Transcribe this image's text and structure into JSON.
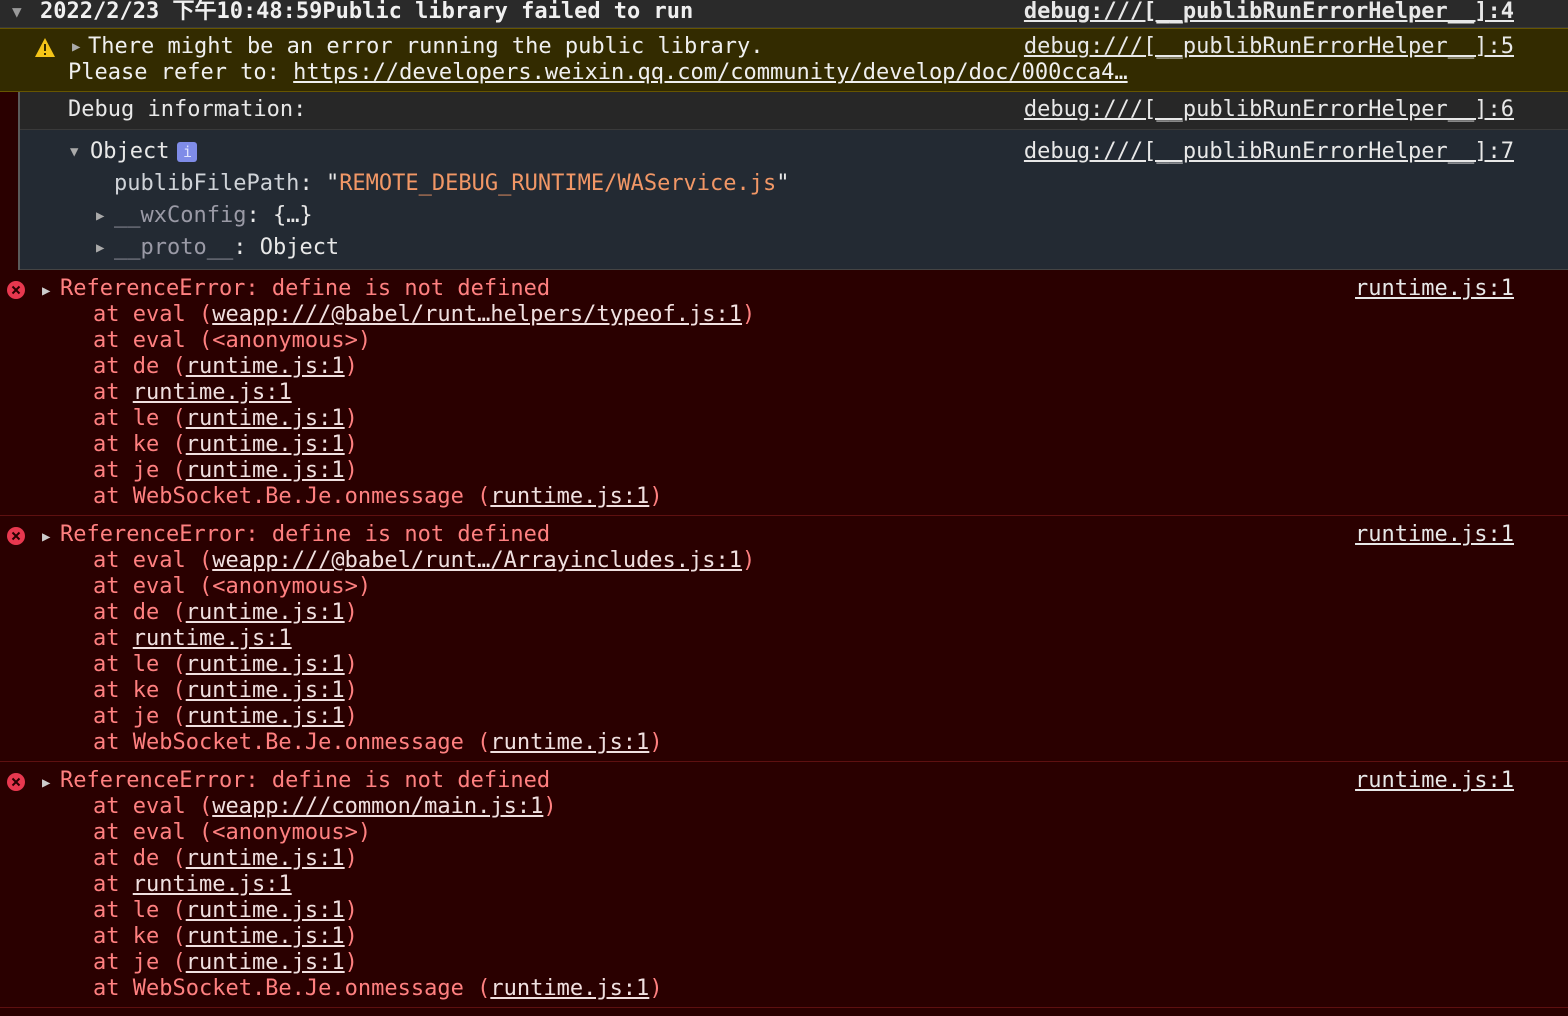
{
  "group": {
    "timestamp_title": "2022/2/23 下午10:48:59Public library failed to run",
    "source": "debug:///[__publibRunErrorHelper__]:4"
  },
  "warning": {
    "line1": "There might be an error running the public library.",
    "line2_prefix": "Please refer to: ",
    "link": "https://developers.weixin.qq.com/community/develop/doc/000cca4…",
    "source": "debug:///[__publibRunErrorHelper__]:5"
  },
  "debug_info": {
    "text": "Debug information:",
    "source": "debug:///[__publibRunErrorHelper__]:6"
  },
  "object": {
    "label": "Object",
    "badge": "i",
    "source": "debug:///[__publibRunErrorHelper__]:7",
    "prop1_key": "publibFilePath",
    "prop1_colon": ": ",
    "prop1_value": "REMOTE_DEBUG_RUNTIME/WAService.js",
    "prop2_key": "__wxConfig",
    "prop2_value": ": {…}",
    "prop3_key": "__proto__",
    "prop3_value": ": Object"
  },
  "errors": [
    {
      "message": "ReferenceError: define is not defined",
      "source": "runtime.js:1",
      "frames": [
        {
          "prefix": "at eval (",
          "link": "weapp:///@babel/runt…helpers/typeof.js:1",
          "suffix": ")"
        },
        {
          "prefix": "at eval (<anonymous>)",
          "link": "",
          "suffix": ""
        },
        {
          "prefix": "at de (",
          "link": "runtime.js:1",
          "suffix": ")"
        },
        {
          "prefix": "at ",
          "link": "runtime.js:1",
          "suffix": ""
        },
        {
          "prefix": "at le (",
          "link": "runtime.js:1",
          "suffix": ")"
        },
        {
          "prefix": "at ke (",
          "link": "runtime.js:1",
          "suffix": ")"
        },
        {
          "prefix": "at je (",
          "link": "runtime.js:1",
          "suffix": ")"
        },
        {
          "prefix": "at WebSocket.Be.Je.onmessage (",
          "link": "runtime.js:1",
          "suffix": ")"
        }
      ]
    },
    {
      "message": "ReferenceError: define is not defined",
      "source": "runtime.js:1",
      "frames": [
        {
          "prefix": "at eval (",
          "link": "weapp:///@babel/runt…/Arrayincludes.js:1",
          "suffix": ")"
        },
        {
          "prefix": "at eval (<anonymous>)",
          "link": "",
          "suffix": ""
        },
        {
          "prefix": "at de (",
          "link": "runtime.js:1",
          "suffix": ")"
        },
        {
          "prefix": "at ",
          "link": "runtime.js:1",
          "suffix": ""
        },
        {
          "prefix": "at le (",
          "link": "runtime.js:1",
          "suffix": ")"
        },
        {
          "prefix": "at ke (",
          "link": "runtime.js:1",
          "suffix": ")"
        },
        {
          "prefix": "at je (",
          "link": "runtime.js:1",
          "suffix": ")"
        },
        {
          "prefix": "at WebSocket.Be.Je.onmessage (",
          "link": "runtime.js:1",
          "suffix": ")"
        }
      ]
    },
    {
      "message": "ReferenceError: define is not defined",
      "source": "runtime.js:1",
      "frames": [
        {
          "prefix": "at eval (",
          "link": "weapp:///common/main.js:1",
          "suffix": ")"
        },
        {
          "prefix": "at eval (<anonymous>)",
          "link": "",
          "suffix": ""
        },
        {
          "prefix": "at de (",
          "link": "runtime.js:1",
          "suffix": ")"
        },
        {
          "prefix": "at ",
          "link": "runtime.js:1",
          "suffix": ""
        },
        {
          "prefix": "at le (",
          "link": "runtime.js:1",
          "suffix": ")"
        },
        {
          "prefix": "at ke (",
          "link": "runtime.js:1",
          "suffix": ")"
        },
        {
          "prefix": "at je (",
          "link": "runtime.js:1",
          "suffix": ")"
        },
        {
          "prefix": "at WebSocket.Be.Je.onmessage (",
          "link": "runtime.js:1",
          "suffix": ")"
        }
      ]
    }
  ]
}
